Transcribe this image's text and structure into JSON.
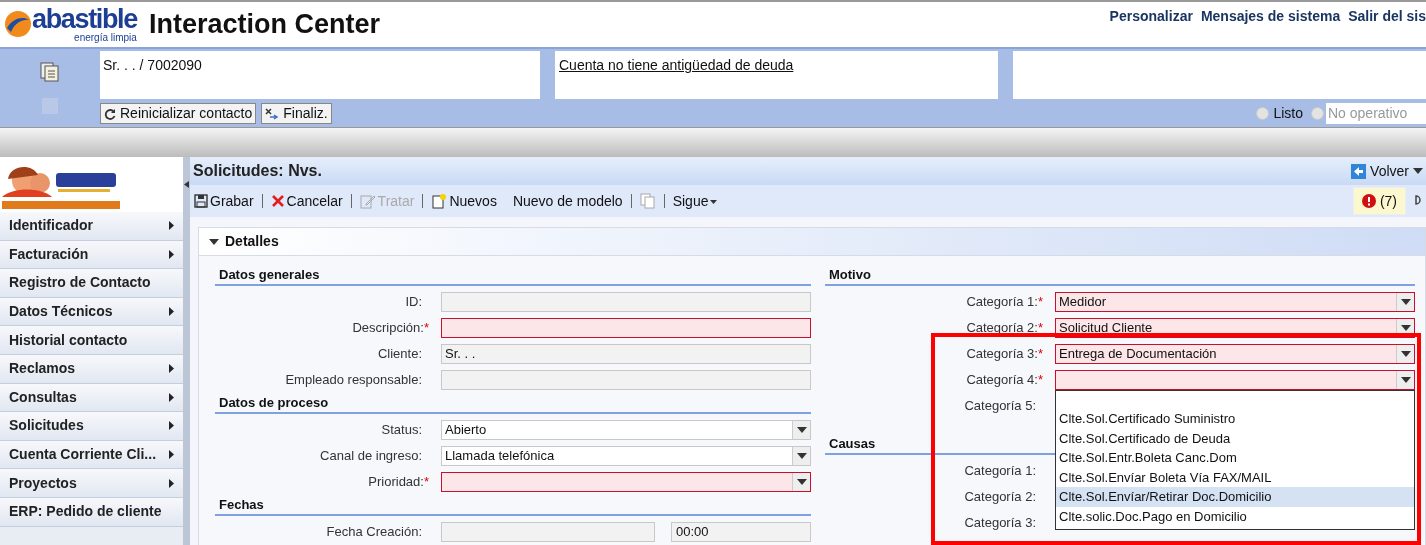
{
  "header": {
    "logo": {
      "name": "abastible",
      "tagline": "energía limpia"
    },
    "title": "Interaction Center",
    "links": [
      "Personalizar",
      "Mensajes de sistema",
      "Salir del sis"
    ]
  },
  "contact_bar": {
    "customer": "Sr. . . / 7002090",
    "notice": "Cuenta no tiene antigüedad de deuda",
    "buttons": [
      {
        "label": "Reinicializar contacto",
        "kind": "refresh"
      },
      {
        "label": "Finaliz.",
        "kind": "end"
      }
    ],
    "availability": [
      {
        "label": "Listo",
        "selected": false,
        "disabled": false
      },
      {
        "label": "No operativo",
        "selected": false,
        "disabled": true
      }
    ]
  },
  "sidebar": {
    "items": [
      {
        "label": "Identificador",
        "has_submenu": true
      },
      {
        "label": "Facturación",
        "has_submenu": true
      },
      {
        "label": "Registro de Contacto",
        "has_submenu": false
      },
      {
        "label": "Datos Técnicos",
        "has_submenu": true
      },
      {
        "label": "Historial contacto",
        "has_submenu": false
      },
      {
        "label": "Reclamos",
        "has_submenu": true
      },
      {
        "label": "Consultas",
        "has_submenu": true
      },
      {
        "label": "Solicitudes",
        "has_submenu": true
      },
      {
        "label": "Cuenta Corriente Cli...",
        "has_submenu": true
      },
      {
        "label": "Proyectos",
        "has_submenu": true
      },
      {
        "label": "ERP: Pedido de cliente",
        "has_submenu": false
      }
    ]
  },
  "page": {
    "title": "Solicitudes: Nvs.",
    "back": "Volver",
    "alerts": "(7)",
    "toolbar": [
      {
        "label": "Grabar",
        "kind": "save",
        "disabled": false
      },
      {
        "label": "Cancelar",
        "kind": "cancel",
        "disabled": false
      },
      {
        "label": "Tratar",
        "kind": "edit",
        "disabled": true
      },
      {
        "label": "Nuevos",
        "kind": "new",
        "disabled": false
      },
      {
        "label": "Nuevo de modelo",
        "kind": "plain",
        "disabled": false
      },
      {
        "kind": "copy",
        "disabled": true
      },
      {
        "label": "Sigue",
        "kind": "menu",
        "disabled": false
      }
    ],
    "details": {
      "title": "Detalles",
      "expanded": true,
      "required_mark": "*",
      "left": [
        {
          "title": "Datos generales",
          "fields": [
            {
              "label": "ID:",
              "kind": "text",
              "readonly": true,
              "required": false
            },
            {
              "label": "Descripción:",
              "kind": "text",
              "readonly": false,
              "required": true
            },
            {
              "label": "Cliente:",
              "kind": "text",
              "readonly": true,
              "required": false,
              "value": "Sr. . ."
            },
            {
              "label": "Empleado responsable:",
              "kind": "text",
              "readonly": true,
              "required": false
            }
          ]
        },
        {
          "title": "Datos de proceso",
          "fields": [
            {
              "label": "Status:",
              "kind": "select",
              "readonly": false,
              "required": false,
              "value": "Abierto"
            },
            {
              "label": "Canal de ingreso:",
              "kind": "select",
              "readonly": false,
              "required": false,
              "value": "Llamada telefónica"
            },
            {
              "label": "Prioridad:",
              "kind": "select",
              "readonly": false,
              "required": true
            }
          ]
        },
        {
          "title": "Fechas",
          "fields": [
            {
              "label": "Fecha Creación:",
              "kind": "datetime",
              "readonly": true,
              "required": false,
              "time": "00:00"
            }
          ]
        }
      ],
      "right": [
        {
          "title": "Motivo",
          "fields": [
            {
              "label": "Categoría 1:",
              "kind": "select",
              "readonly": false,
              "required": true,
              "value": "Medidor"
            },
            {
              "label": "Categoría 2:",
              "kind": "select",
              "readonly": false,
              "required": true,
              "value": "Solicitud Cliente"
            },
            {
              "label": "Categoría 3:",
              "kind": "select",
              "readonly": false,
              "required": true,
              "value": "Entrega de Documentación"
            },
            {
              "label": "Categoría 4:",
              "kind": "select",
              "readonly": false,
              "required": true,
              "expanded": true,
              "options": [
                {
                  "label": "Clte.Sol.Certificado Suministro",
                  "selected": false
                },
                {
                  "label": "Clte.Sol.Certificado de Deuda",
                  "selected": false
                },
                {
                  "label": "Clte.Sol.Entr.Boleta Canc.Dom",
                  "selected": false
                },
                {
                  "label": "Clte.Sol.Envíar Boleta Vía FAX/MAIL",
                  "selected": false
                },
                {
                  "label": "Clte.Sol.Envíar/Retirar Doc.Domicilio",
                  "selected": true
                },
                {
                  "label": "Clte.solic.Doc.Pago en Domicilio",
                  "selected": false
                }
              ]
            },
            {
              "label": "Categoría 5:",
              "required": false
            }
          ]
        },
        {
          "title": "Causas",
          "fields": [
            {
              "label": "Categoría 1:",
              "required": false
            },
            {
              "label": "Categoría 2:",
              "required": false
            },
            {
              "label": "Categoría 3:",
              "required": false
            }
          ]
        }
      ]
    }
  }
}
